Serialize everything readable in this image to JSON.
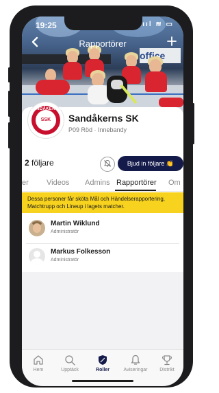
{
  "status": {
    "time": "19:25",
    "icons": "ııl ≋ ▭"
  },
  "nav": {
    "title": "Rapportörer",
    "back_icon": "chevron-left-icon",
    "add_icon": "plus-icon"
  },
  "hero": {
    "sign_text": "office"
  },
  "club": {
    "name": "Sandåkerns SK",
    "subtitle": "P09 Röd · Innebandy",
    "logo_ring": "SANDÅKERNS",
    "logo_center": "SSK"
  },
  "followers": {
    "count": "2",
    "label": "följare"
  },
  "invite_button": {
    "label": "Bjud in följare 👏"
  },
  "tabs": [
    {
      "label": "er"
    },
    {
      "label": "Videos"
    },
    {
      "label": "Admins"
    },
    {
      "label": "Rapportörer",
      "active": true
    },
    {
      "label": "Om"
    }
  ],
  "info_text": "Dessa personer får sköta Mål och Händelserapportering, Matchtrupp och Lineup i lagets matcher.",
  "reporters": [
    {
      "name": "Martin Wiklund",
      "role": "Administratör"
    },
    {
      "name": "Markus Folkesson",
      "role": "Administratör"
    }
  ],
  "bottom_tabs": [
    {
      "label": "Hem",
      "icon": "home-icon"
    },
    {
      "label": "Upptäck",
      "icon": "search-icon"
    },
    {
      "label": "Roller",
      "icon": "shield-icon",
      "active": true
    },
    {
      "label": "Aviseringar",
      "icon": "bell-icon"
    },
    {
      "label": "Distrikt",
      "icon": "trophy-icon"
    }
  ],
  "colors": {
    "accent": "#141a4a",
    "info_bg": "#f7d21e",
    "brand_red": "#c8102e"
  }
}
